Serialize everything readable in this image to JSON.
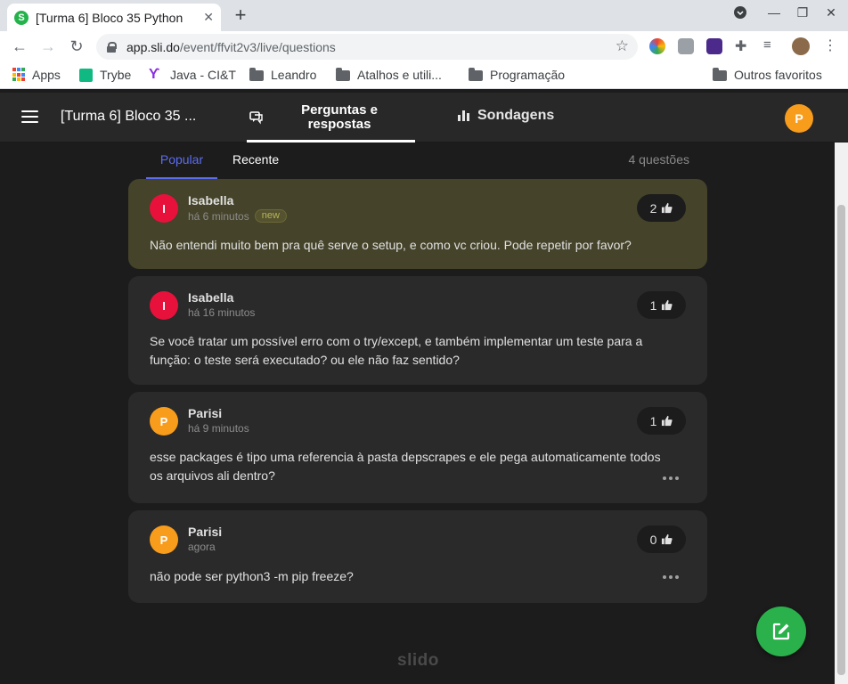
{
  "browser": {
    "tab_title": "[Turma 6] Bloco 35 Python",
    "favicon_letter": "S",
    "url_host": "app.sli.do",
    "url_path": "/event/ffvit2v3/live/questions",
    "bookmarks": [
      "Apps",
      "Trybe",
      "Java - CI&T",
      "Leandro",
      "Atalhos e utili...",
      "Programação"
    ],
    "other_bookmarks": "Outros favoritos"
  },
  "header": {
    "event_title": "[Turma 6] Bloco 35 ...",
    "nav_qa": "Perguntas e respostas",
    "nav_polls": "Sondagens",
    "user_initial": "P"
  },
  "sort": {
    "popular": "Popular",
    "recent": "Recente",
    "count": "4 questões"
  },
  "questions": [
    {
      "initial": "I",
      "author": "Isabella",
      "time": "há 6 minutos",
      "badge": "new",
      "likes": "2",
      "text": "Não entendi muito bem pra quê serve o setup, e como vc criou. Pode repetir por favor?",
      "avatar_color": "#e8113c"
    },
    {
      "initial": "I",
      "author": "Isabella",
      "time": "há 16 minutos",
      "likes": "1",
      "text": "Se você tratar um possível erro com o try/except, e também implementar um teste para a função: o teste será executado? ou ele não faz sentido?",
      "avatar_color": "#e8113c"
    },
    {
      "initial": "P",
      "author": "Parisi",
      "time": "há 9 minutos",
      "likes": "1",
      "text": "esse packages é tipo uma referencia à pasta depscrapes e ele pega automaticamente todos os arquivos ali dentro?",
      "avatar_color": "#f89c1c"
    },
    {
      "initial": "P",
      "author": "Parisi",
      "time": "agora",
      "likes": "0",
      "text": "não pode ser python3 -m pip freeze?",
      "avatar_color": "#f89c1c"
    }
  ],
  "footer": {
    "logo": "slido"
  },
  "colors": {
    "accent": "#5b6cf0",
    "highlight_card": "#45432a",
    "fab": "#2ab14c"
  }
}
